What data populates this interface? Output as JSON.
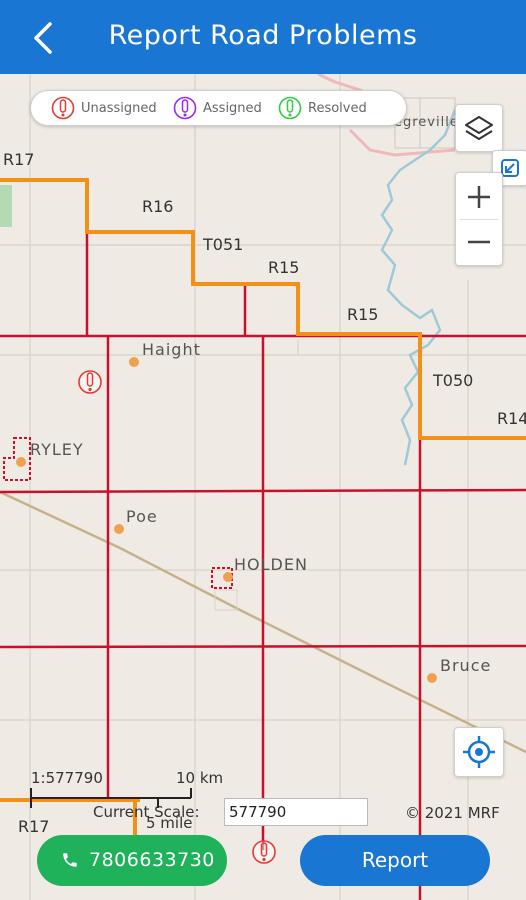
{
  "header": {
    "title": "Report Road Problems"
  },
  "legend": {
    "unassigned": "Unassigned",
    "assigned": "Assigned",
    "resolved": "Resolved"
  },
  "colors": {
    "unassigned": "#e53935",
    "assigned": "#9c27f0",
    "resolved": "#2ecc40",
    "primary": "#1976d2",
    "phone": "#1fb25a",
    "roads_major": "#f39015",
    "roads_grid": "#c8102e"
  },
  "map": {
    "road_labels": [
      "R17",
      "R16",
      "T051",
      "R15",
      "R15",
      "T050",
      "R14",
      "R17"
    ],
    "places": [
      "Haight",
      "RYLEY",
      "Poe",
      "HOLDEN",
      "Bruce",
      "egreville"
    ],
    "scale_ratio": "1:577790",
    "scale_km": "10 km",
    "scale_mile": "5 mile",
    "current_scale_label": "Current Scale:",
    "current_scale_value": "577790",
    "copyright": "© 2021 MRF"
  },
  "actions": {
    "phone": "7806633730",
    "report": "Report"
  },
  "icons": [
    "back-chevron-icon",
    "layers-icon",
    "expand-icon",
    "zoom-in-icon",
    "zoom-out-icon",
    "locate-icon",
    "phone-icon",
    "problem-marker-icon"
  ]
}
